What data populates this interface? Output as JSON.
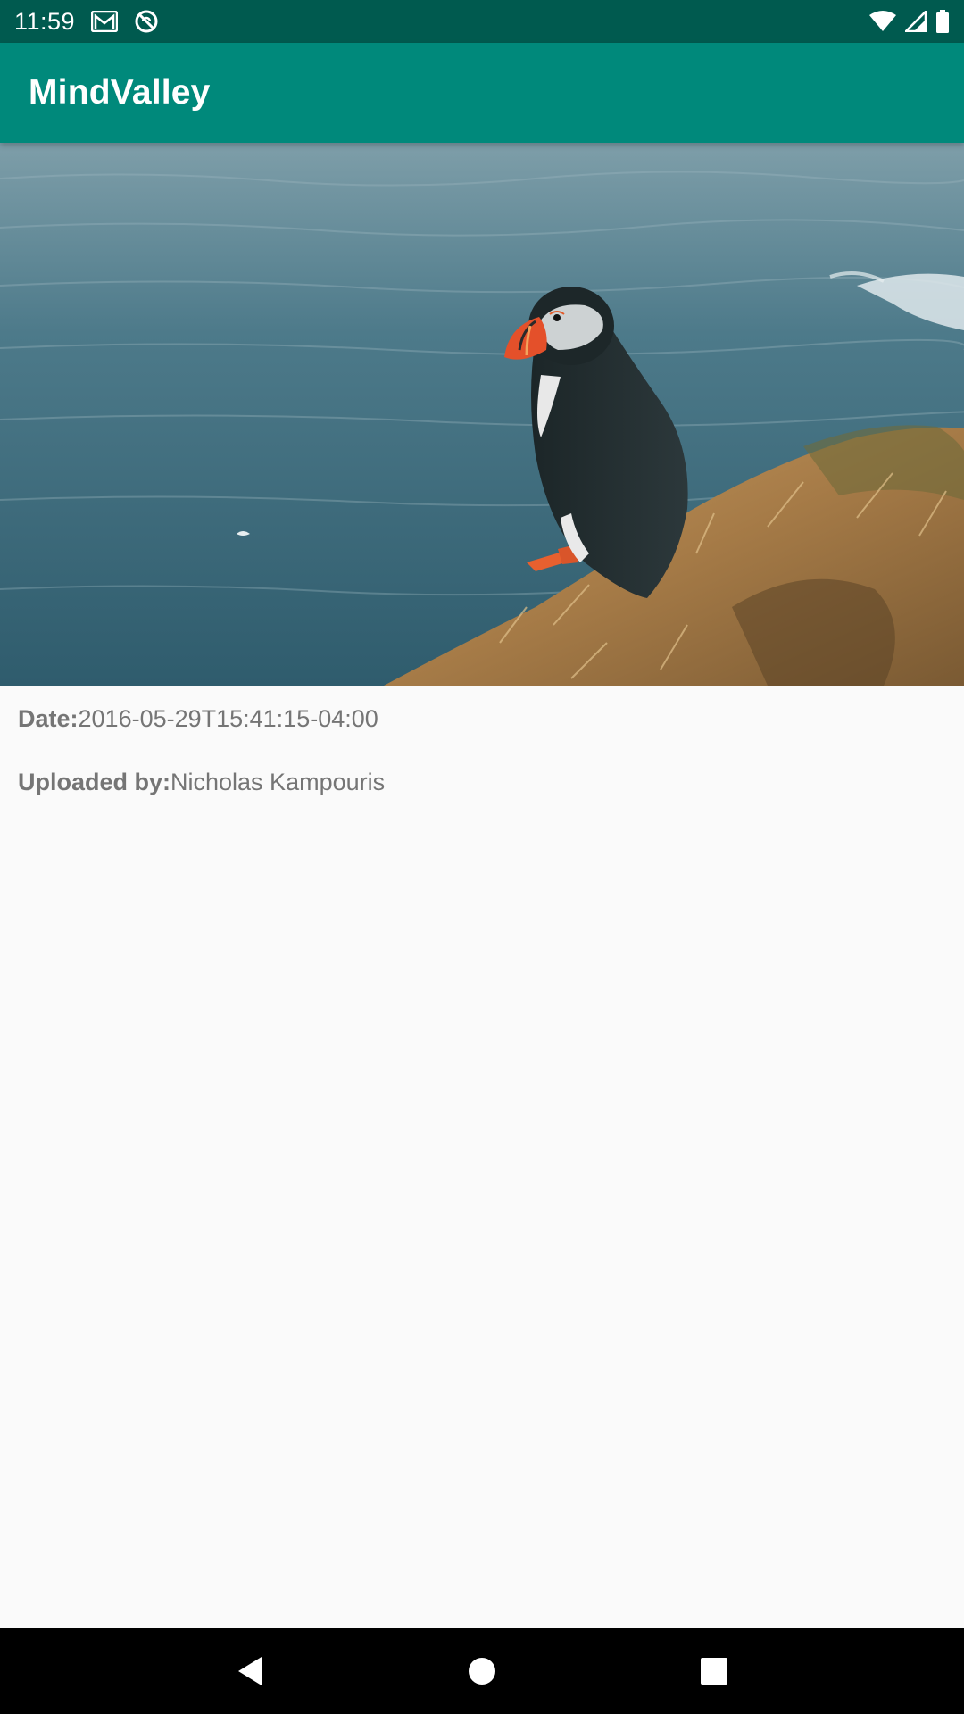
{
  "status_bar": {
    "time": "11:59",
    "icons": [
      "gmail-icon",
      "no-sync-icon",
      "wifi-icon",
      "signal-icon",
      "battery-icon"
    ]
  },
  "app_bar": {
    "title": "MindValley",
    "color": "#00897b",
    "status_color": "#005a4f"
  },
  "photo": {
    "subject": "puffin-photo"
  },
  "details": {
    "date_label": "Date:",
    "date_value": "2016-05-29T15:41:15-04:00",
    "uploader_label": "Uploaded by:",
    "uploader_value": "Nicholas Kampouris"
  },
  "nav_bar": {
    "buttons": [
      "back-icon",
      "home-icon",
      "recents-icon"
    ]
  }
}
